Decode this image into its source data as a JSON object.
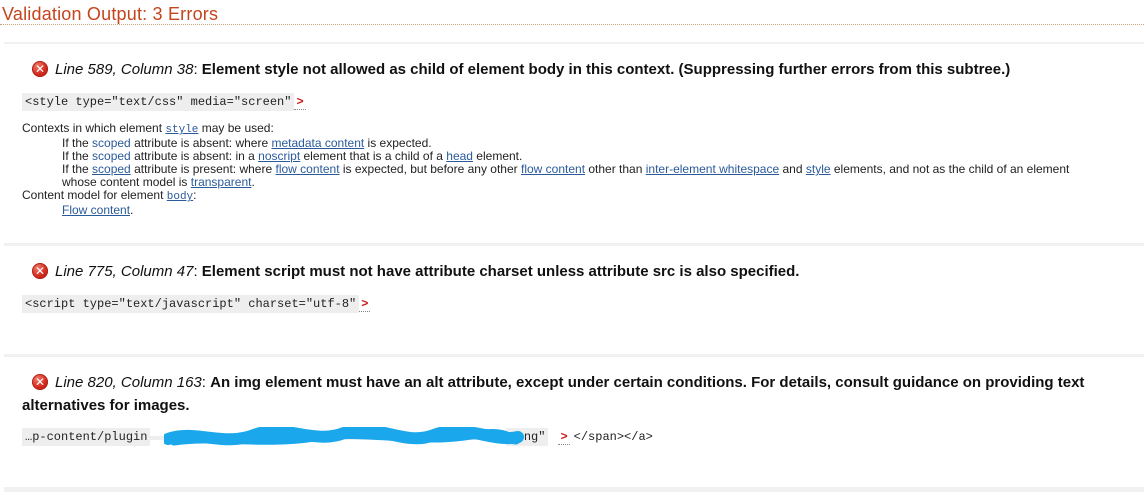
{
  "header": {
    "title": "Validation Output: 3 Errors"
  },
  "errors": [
    {
      "location": "Line 589, Column 38",
      "message": "Element style not allowed as child of element body in this context. (Suppressing further errors from this subtree.)",
      "code": "<style type=\"text/css\" media=\"screen\"",
      "marker": ">",
      "context": {
        "intro_prefix": "Contexts in which element ",
        "intro_element": "style",
        "intro_suffix": " may be used:",
        "lines": [
          {
            "a": "If the ",
            "b": "scoped",
            "c": " attribute is absent: where ",
            "d": "metadata content",
            "e": " is expected."
          },
          {
            "a": "If the ",
            "b": "scoped",
            "c": " attribute is absent: in a ",
            "d": "noscript",
            "e": " element that is a child of a ",
            "f": "head",
            "g": " element."
          },
          {
            "a": "If the ",
            "b": "scoped",
            "c": " attribute is present: where ",
            "d": "flow content",
            "e": " is expected, but before any other ",
            "f": "flow content",
            "g": " other than ",
            "h": "inter-element whitespace",
            "i": " and ",
            "j": "style",
            "k": " elements, and not as the child of an element"
          },
          {
            "a": "whose content model is ",
            "b": "transparent",
            "c": "."
          }
        ],
        "model_prefix": "Content model for element ",
        "model_element": "body",
        "model_suffix": ":",
        "model_value": "Flow content",
        "model_value_suffix": "."
      }
    },
    {
      "location": "Line 775, Column 47",
      "message": "Element script must not have attribute charset unless attribute src is also specified.",
      "code": "<script type=\"text/javascript\" charset=\"utf-8\"",
      "marker": ">"
    },
    {
      "location": "Line 820, Column 163",
      "message_line1": "An img element must have an alt attribute, except under certain conditions. For details, consult guidance on providing text",
      "message_line2": "alternatives for images.",
      "code_prefix": "…p-content/plugin",
      "code_suffix": ".png\"",
      "marker": ">",
      "code_tail": "</span></a>"
    }
  ],
  "colors": {
    "heading": "#c4441c",
    "error_icon": "#d42a1e",
    "link": "#2a5a9a",
    "redaction": "#1aa7ec"
  },
  "icons": {
    "error": "error-x-circle-icon"
  }
}
